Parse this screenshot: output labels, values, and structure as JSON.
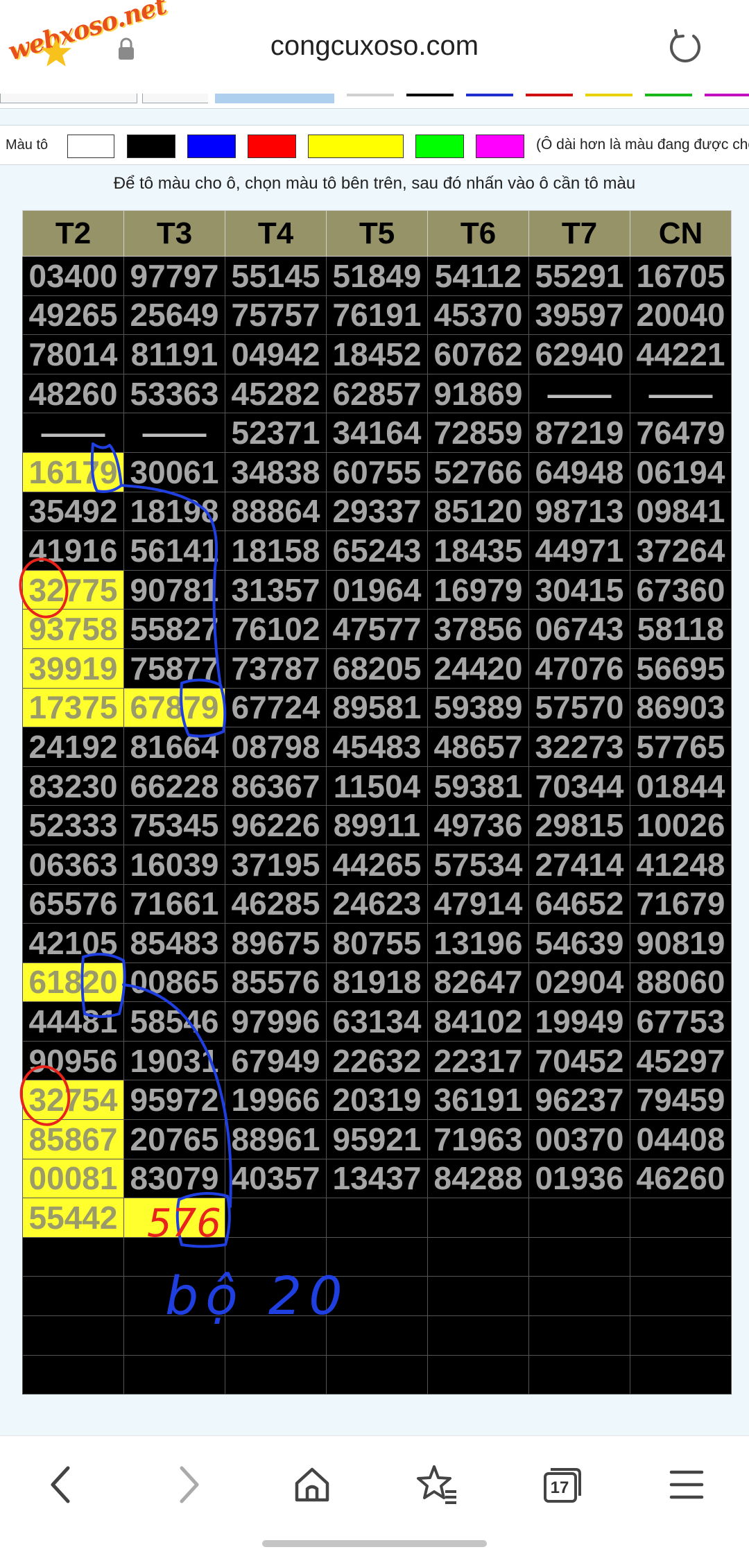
{
  "browser": {
    "brand_text": "webxoso.net",
    "url": "congcuxoso.com",
    "tabs_count": "17"
  },
  "palette": {
    "label": "Màu tô",
    "colors": [
      "#ffffff",
      "#000000",
      "#0000ff",
      "#ff0000",
      "#ffff00",
      "#00ff00",
      "#ff00ff"
    ],
    "selected_color": "#ffff00",
    "note": "(Ô dài hơn là màu đang được chọn)"
  },
  "instruction": "Để tô màu cho ô, chọn màu tô bên trên, sau đó nhấn vào ô cần tô màu",
  "table": {
    "headers": [
      "T2",
      "T3",
      "T4",
      "T5",
      "T6",
      "T7",
      "CN"
    ],
    "rows": [
      [
        "03400",
        "97797",
        "55145",
        "51849",
        "54112",
        "55291",
        "16705"
      ],
      [
        "49265",
        "25649",
        "75757",
        "76191",
        "45370",
        "39597",
        "20040"
      ],
      [
        "78014",
        "81191",
        "04942",
        "18452",
        "60762",
        "62940",
        "44221"
      ],
      [
        "48260",
        "53363",
        "45282",
        "62857",
        "91869",
        "——",
        "——"
      ],
      [
        "——",
        "——",
        "52371",
        "34164",
        "72859",
        "87219",
        "76479"
      ],
      [
        "16179",
        "30061",
        "34838",
        "60755",
        "52766",
        "64948",
        "06194"
      ],
      [
        "35492",
        "18198",
        "88864",
        "29337",
        "85120",
        "98713",
        "09841"
      ],
      [
        "41916",
        "56141",
        "18158",
        "65243",
        "18435",
        "44971",
        "37264"
      ],
      [
        "32775",
        "90781",
        "31357",
        "01964",
        "16979",
        "30415",
        "67360"
      ],
      [
        "93758",
        "55827",
        "76102",
        "47577",
        "37856",
        "06743",
        "58118"
      ],
      [
        "39919",
        "75877",
        "73787",
        "68205",
        "24420",
        "47076",
        "56695"
      ],
      [
        "17375",
        "67879",
        "67724",
        "89581",
        "59389",
        "57570",
        "86903"
      ],
      [
        "24192",
        "81664",
        "08798",
        "45483",
        "48657",
        "32273",
        "57765"
      ],
      [
        "83230",
        "66228",
        "86367",
        "11504",
        "59381",
        "70344",
        "01844"
      ],
      [
        "52333",
        "75345",
        "96226",
        "89911",
        "49736",
        "29815",
        "10026"
      ],
      [
        "06363",
        "16039",
        "37195",
        "44265",
        "57534",
        "27414",
        "41248"
      ],
      [
        "65576",
        "71661",
        "46285",
        "24623",
        "47914",
        "64652",
        "71679"
      ],
      [
        "42105",
        "85483",
        "89675",
        "80755",
        "13196",
        "54639",
        "90819"
      ],
      [
        "61820",
        "00865",
        "85576",
        "81918",
        "82647",
        "02904",
        "88060"
      ],
      [
        "44481",
        "58546",
        "97996",
        "63134",
        "84102",
        "19949",
        "67753"
      ],
      [
        "90956",
        "19031",
        "67949",
        "22632",
        "22317",
        "70452",
        "45297"
      ],
      [
        "32754",
        "95972",
        "19966",
        "20319",
        "36191",
        "96237",
        "79459"
      ],
      [
        "85867",
        "20765",
        "88961",
        "95921",
        "71963",
        "00370",
        "04408"
      ],
      [
        "00081",
        "83079",
        "40357",
        "13437",
        "84288",
        "01936",
        "46260"
      ],
      [
        "55442",
        "",
        "",
        "",
        "",
        "",
        ""
      ],
      [
        "",
        "",
        "",
        "",
        "",
        "",
        ""
      ],
      [
        "",
        "",
        "",
        "",
        "",
        "",
        ""
      ],
      [
        "",
        "",
        "",
        "",
        "",
        "",
        ""
      ],
      [
        "",
        "",
        "",
        "",
        "",
        "",
        ""
      ]
    ],
    "highlighted": [
      [
        5,
        0
      ],
      [
        8,
        0
      ],
      [
        9,
        0
      ],
      [
        10,
        0
      ],
      [
        11,
        0
      ],
      [
        11,
        1
      ],
      [
        18,
        0
      ],
      [
        21,
        0
      ],
      [
        22,
        0
      ],
      [
        23,
        0
      ],
      [
        24,
        0
      ],
      [
        24,
        1
      ]
    ],
    "highlight_color": "#ffff2e"
  },
  "annotations": {
    "red_note": "576",
    "blue_note": "bộ 20",
    "ink_blue": "#1f3fe0",
    "ink_red": "#e8231c"
  }
}
